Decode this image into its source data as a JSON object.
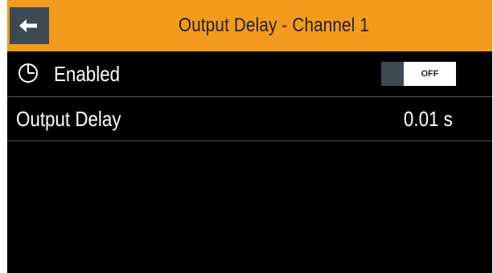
{
  "header": {
    "title": "Output Delay - Channel 1",
    "back_icon": "arrow-left-icon"
  },
  "rows": {
    "enabled": {
      "icon": "clock-icon",
      "label": "Enabled",
      "toggle_state": "OFF"
    },
    "output_delay": {
      "label": "Output Delay",
      "value": "0.01 s"
    }
  },
  "colors": {
    "header_bg": "#f39a1c",
    "screen_bg": "#000000",
    "button_bg": "#3d4a52",
    "divider": "#5a5a5a",
    "text": "#ffffff"
  }
}
